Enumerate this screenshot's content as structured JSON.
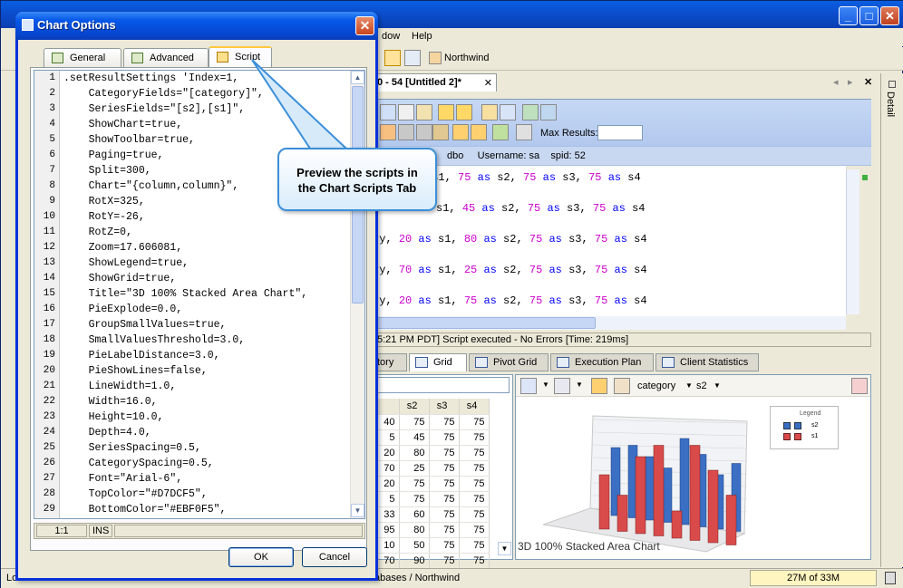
{
  "app": {
    "menu": {
      "window_fragment": "dow",
      "help": "Help"
    },
    "toolbar": {
      "northwind": "Northwind"
    },
    "document_tab": "0 - 54 [Untitled 2]*",
    "right_panel_label": "Detail",
    "query_toolbar": {
      "max_results_label": "Max Results:",
      "max_results_value": ""
    },
    "connection": {
      "schema": "dbo",
      "username_label": "Username:",
      "username": "sa",
      "spid_label": "spid:",
      "spid": "52"
    },
    "editor_lines": [
      {
        "pre": " ",
        "a": "s1, ",
        "n1": "75",
        "k1": "as",
        "b": " s2, ",
        "n2": "75",
        "k2": "as",
        "c": " s3, ",
        "n3": "75",
        "k3": "as",
        "d": " s4"
      },
      {
        "pre": "",
        "a": "s1, ",
        "n1": "45",
        "k1": "as",
        "b": " s2, ",
        "n2": "75",
        "k2": "as",
        "c": " s3, ",
        "n3": "75",
        "k3": "as",
        "d": " s4"
      },
      {
        "pre": "ry, ",
        "a": "",
        "n0": "20",
        "k0": "as",
        "a2": " s1, ",
        "n1": "80",
        "k1": "as",
        "b": " s2, ",
        "n2": "75",
        "k2": "as",
        "c": " s3, ",
        "n3": "75",
        "k3": "as",
        "d": " s4"
      },
      {
        "pre": "ry, ",
        "a": "",
        "n0": "70",
        "k0": "as",
        "a2": " s1, ",
        "n1": "25",
        "k1": "as",
        "b": " s2, ",
        "n2": "75",
        "k2": "as",
        "c": " s3, ",
        "n3": "75",
        "k3": "as",
        "d": " s4"
      },
      {
        "pre": "ry, ",
        "a": "",
        "n0": "20",
        "k0": "as",
        "a2": " s1, ",
        "n1": "75",
        "k1": "as",
        "b": " s2, ",
        "n2": "75",
        "k2": "as",
        "c": " s3, ",
        "n3": "75",
        "k3": "as",
        "d": " s4"
      }
    ],
    "status_message": "5:21 PM PDT] Script executed - No Errors [Time: 219ms]",
    "result_tabs": [
      "tory",
      "Grid",
      "Pivot Grid",
      "Execution Plan",
      "Client Statistics"
    ],
    "grid": {
      "headers": [
        "",
        "s2",
        "s3",
        "s4"
      ],
      "rows": [
        [
          "40",
          "75",
          "75",
          "75"
        ],
        [
          "5",
          "45",
          "75",
          "75"
        ],
        [
          "20",
          "80",
          "75",
          "75"
        ],
        [
          "70",
          "25",
          "75",
          "75"
        ],
        [
          "20",
          "75",
          "75",
          "75"
        ],
        [
          "5",
          "75",
          "75",
          "75"
        ],
        [
          "33",
          "60",
          "75",
          "75"
        ],
        [
          "95",
          "80",
          "75",
          "75"
        ],
        [
          "10",
          "50",
          "75",
          "75"
        ],
        [
          "70",
          "90",
          "75",
          "75"
        ]
      ]
    },
    "chart_toolbar": {
      "category": "category",
      "series": "s2"
    },
    "chart_title": "3D 100% Stacked Area Chart",
    "legend": {
      "title": "Legend",
      "items": [
        "s2",
        "s1"
      ]
    },
    "statusbar": {
      "left": "Lo",
      "middle": "abases / Northwind",
      "memory": "27M of 33M"
    }
  },
  "dialog": {
    "title": "Chart Options",
    "tabs": [
      "General",
      "Advanced",
      "Script"
    ],
    "code_lines": [
      ".setResultSettings 'Index=1,",
      "    CategoryFields=\"[category]\",",
      "    SeriesFields=\"[s2],[s1]\",",
      "    ShowChart=true,",
      "    ShowToolbar=true,",
      "    Paging=true,",
      "    Split=300,",
      "    Chart=\"{column,column}\",",
      "    RotX=325,",
      "    RotY=-26,",
      "    RotZ=0,",
      "    Zoom=17.606081,",
      "    ShowLegend=true,",
      "    ShowGrid=true,",
      "    Title=\"3D 100% Stacked Area Chart\",",
      "    PieExplode=0.0,",
      "    GroupSmallValues=true,",
      "    SmallValuesThreshold=3.0,",
      "    PieLabelDistance=3.0,",
      "    PieShowLines=false,",
      "    LineWidth=1.0,",
      "    Width=16.0,",
      "    Height=10.0,",
      "    Depth=4.0,",
      "    SeriesSpacing=0.5,",
      "    CategorySpacing=0.5,",
      "    Font=\"Arial-6\",",
      "    TopColor=\"#D7DCF5\",",
      "    BottomColor=\"#EBF0F5\","
    ],
    "line_numbers": [
      "1",
      "2",
      "3",
      "4",
      "5",
      "6",
      "7",
      "8",
      "9",
      "10",
      "11",
      "12",
      "13",
      "14",
      "15",
      "16",
      "17",
      "18",
      "19",
      "20",
      "21",
      "22",
      "23",
      "24",
      "25",
      "26",
      "27",
      "28",
      "29"
    ],
    "cursor_pos": "1:1",
    "insert_mode": "INS",
    "ok": "OK",
    "cancel": "Cancel"
  },
  "callout": {
    "line1": "Preview the scripts in",
    "line2": "the Chart Scripts Tab"
  },
  "chart_series": {
    "s1_color": "#d94a4a",
    "s2_color": "#3a6fc4"
  }
}
